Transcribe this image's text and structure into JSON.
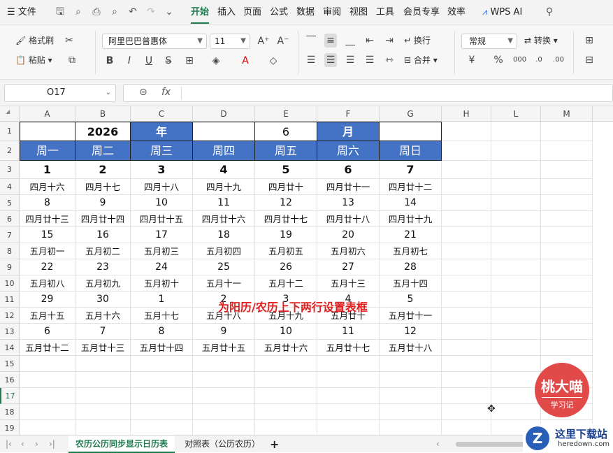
{
  "titlebar": {
    "menu_label": "文件",
    "tabs": [
      "开始",
      "插入",
      "页面",
      "公式",
      "数据",
      "审阅",
      "视图",
      "工具",
      "会员专享",
      "效率"
    ],
    "active_tab": "开始",
    "ai_label": "WPS AI"
  },
  "ribbon": {
    "format_painter": "格式刷",
    "paste": "粘贴",
    "font_name": "阿里巴巴普惠体",
    "font_size": "11",
    "wrap": "换行",
    "merge": "合并",
    "number_format": "常规",
    "convert": "转换",
    "bold": "B",
    "italic": "I",
    "underline": "U"
  },
  "formula": {
    "cell_ref": "O17",
    "fx": "fx",
    "value": ""
  },
  "columns": [
    "A",
    "B",
    "C",
    "D",
    "E",
    "F",
    "G",
    "H",
    "L",
    "M"
  ],
  "rows": [
    "1",
    "2",
    "3",
    "4",
    "5",
    "6",
    "7",
    "8",
    "9",
    "10",
    "11",
    "12",
    "13",
    "14",
    "15",
    "16",
    "17",
    "18",
    "19"
  ],
  "calendar": {
    "row1": [
      "",
      "2026",
      "年",
      "",
      "6",
      "月",
      ""
    ],
    "weekdays": [
      "周一",
      "周二",
      "周三",
      "周四",
      "周五",
      "周六",
      "周日"
    ],
    "grid": [
      [
        "1",
        "2",
        "3",
        "4",
        "5",
        "6",
        "7"
      ],
      [
        "四月十六",
        "四月十七",
        "四月十八",
        "四月十九",
        "四月廿十",
        "四月廿十一",
        "四月廿十二"
      ],
      [
        "8",
        "9",
        "10",
        "11",
        "12",
        "13",
        "14"
      ],
      [
        "四月廿十三",
        "四月廿十四",
        "四月廿十五",
        "四月廿十六",
        "四月廿十七",
        "四月廿十八",
        "四月廿十九"
      ],
      [
        "15",
        "16",
        "17",
        "18",
        "19",
        "20",
        "21"
      ],
      [
        "五月初一",
        "五月初二",
        "五月初三",
        "五月初四",
        "五月初五",
        "五月初六",
        "五月初七"
      ],
      [
        "22",
        "23",
        "24",
        "25",
        "26",
        "27",
        "28"
      ],
      [
        "五月初八",
        "五月初九",
        "五月初十",
        "五月十一",
        "五月十二",
        "五月十三",
        "五月十四"
      ],
      [
        "29",
        "30",
        "1",
        "2",
        "3",
        "4",
        "5"
      ],
      [
        "五月十五",
        "五月十六",
        "五月十七",
        "五月十八",
        "五月十九",
        "五月廿十",
        "五月廿十一"
      ],
      [
        "6",
        "7",
        "8",
        "9",
        "10",
        "11",
        "12"
      ],
      [
        "五月廿十二",
        "五月廿十三",
        "五月廿十四",
        "五月廿十五",
        "五月廿十六",
        "五月廿十七",
        "五月廿十八"
      ]
    ]
  },
  "caption": "为阳历/农历上下两行设置表框",
  "sheets": {
    "active": "农历公历同步显示日历表",
    "other": "对照表（公历农历）",
    "add": "+"
  },
  "badge": {
    "name": "桃大喵",
    "sub": "学习记"
  },
  "watermark": {
    "name": "这里下载站",
    "url": "heredown.com"
  },
  "colors": {
    "accent": "#1e7b4e",
    "header_blue": "#4472c4",
    "caption_red": "#e02020"
  }
}
